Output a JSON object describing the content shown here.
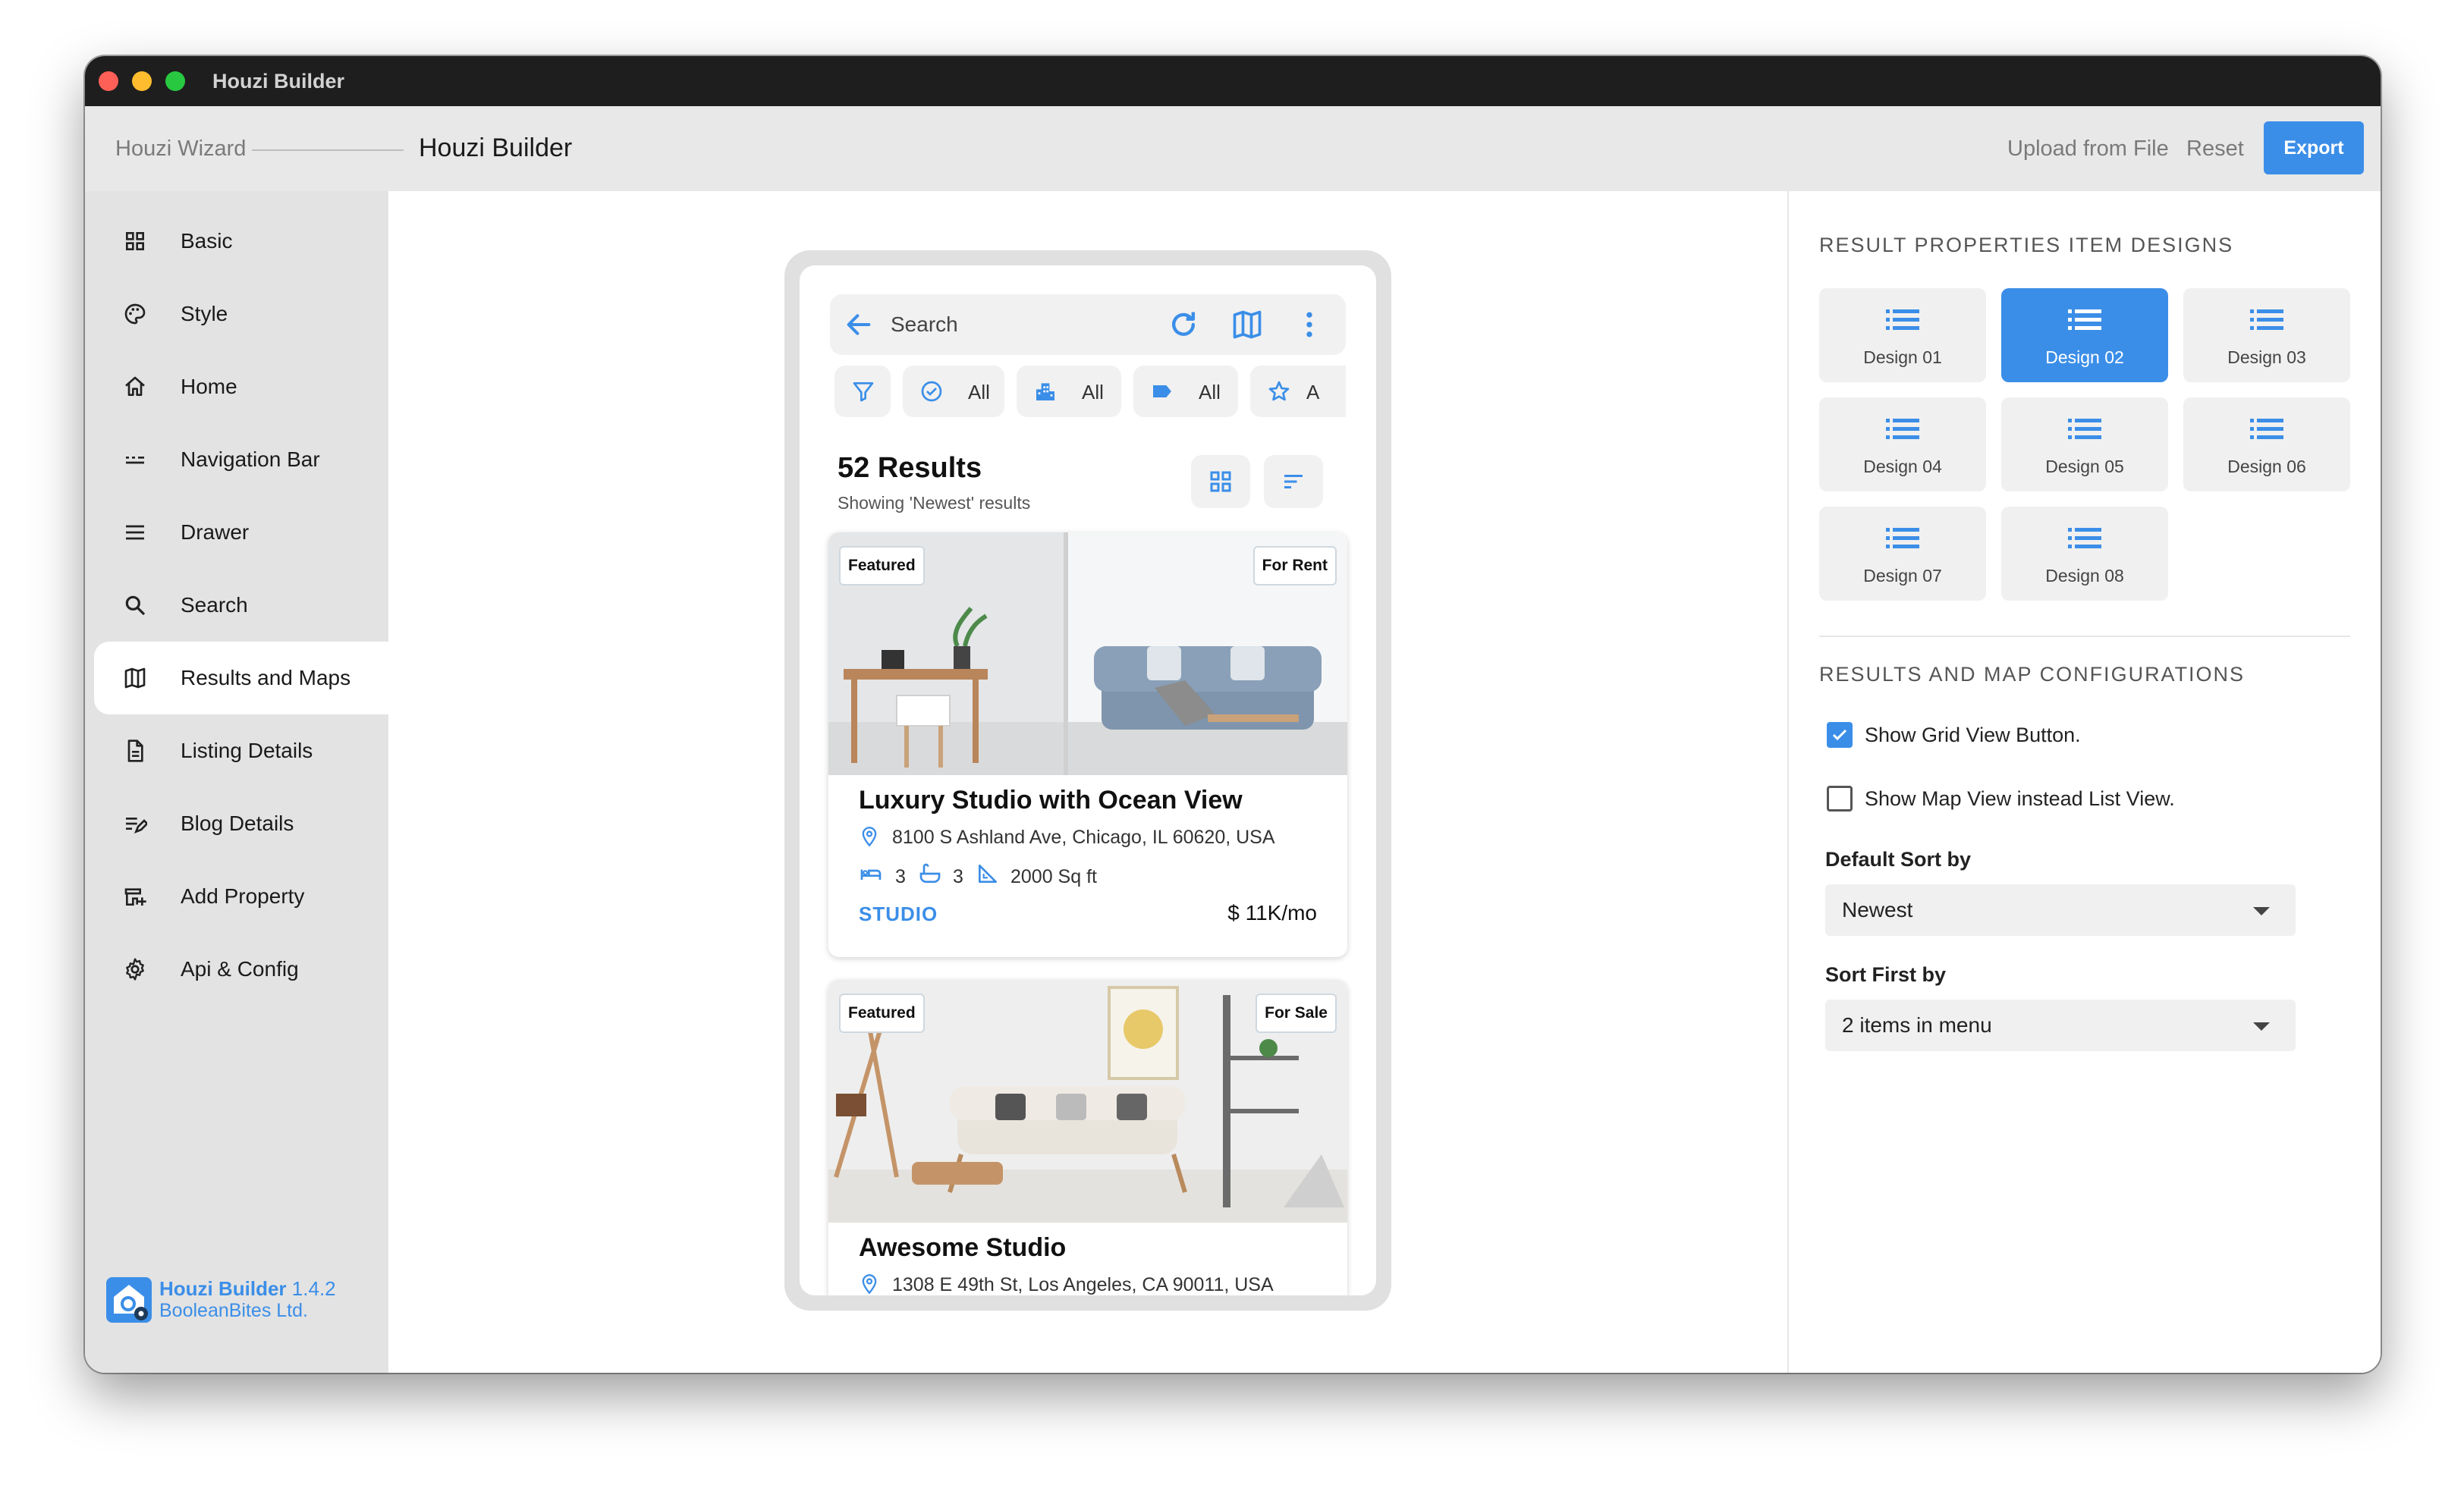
{
  "window": {
    "title": "Houzi Builder"
  },
  "topbar": {
    "breadcrumb_root": "Houzi Wizard",
    "title": "Houzi Builder",
    "upload_label": "Upload from File",
    "reset_label": "Reset",
    "export_label": "Export"
  },
  "sidebar": {
    "items": [
      {
        "label": "Basic",
        "icon": "grid-icon"
      },
      {
        "label": "Style",
        "icon": "palette-icon"
      },
      {
        "label": "Home",
        "icon": "home-icon"
      },
      {
        "label": "Navigation Bar",
        "icon": "navigation-bar-icon"
      },
      {
        "label": "Drawer",
        "icon": "menu-icon"
      },
      {
        "label": "Search",
        "icon": "search-icon"
      },
      {
        "label": "Results and Maps",
        "icon": "map-icon",
        "active": true
      },
      {
        "label": "Listing Details",
        "icon": "document-icon"
      },
      {
        "label": "Blog Details",
        "icon": "edit-list-icon"
      },
      {
        "label": "Add Property",
        "icon": "add-property-icon"
      },
      {
        "label": "Api & Config",
        "icon": "gear-icon"
      }
    ],
    "brand": {
      "name": "Houzi Builder",
      "version": "1.4.2",
      "company": "BooleanBites Ltd."
    }
  },
  "preview": {
    "search_placeholder": "Search",
    "filter_chips": [
      {
        "icon": "funnel-icon",
        "label": ""
      },
      {
        "icon": "check-circle-icon",
        "label": "All"
      },
      {
        "icon": "city-icon",
        "label": "All"
      },
      {
        "icon": "tag-icon",
        "label": "All"
      },
      {
        "icon": "star-icon",
        "label": "A"
      }
    ],
    "results_title": "52 Results",
    "results_subtitle": "Showing 'Newest' results",
    "listings": [
      {
        "badge_left": "Featured",
        "badge_right": "For Rent",
        "title": "Luxury Studio with Ocean View",
        "address": "8100 S Ashland Ave, Chicago, IL 60620, USA",
        "beds": "3",
        "baths": "3",
        "area": "2000 Sq ft",
        "type": "STUDIO",
        "price": "$ 11K/mo"
      },
      {
        "badge_left": "Featured",
        "badge_right": "For Sale",
        "title": "Awesome Studio",
        "address": "1308 E 49th St, Los Angeles, CA 90011, USA"
      }
    ]
  },
  "panel": {
    "designs_title": "RESULT PROPERTIES ITEM DESIGNS",
    "designs": [
      {
        "label": "Design 01"
      },
      {
        "label": "Design 02",
        "selected": true
      },
      {
        "label": "Design 03"
      },
      {
        "label": "Design 04"
      },
      {
        "label": "Design 05"
      },
      {
        "label": "Design 06"
      },
      {
        "label": "Design 07"
      },
      {
        "label": "Design 08"
      }
    ],
    "config_title": "RESULTS AND MAP CONFIGURATIONS",
    "show_grid_label": "Show Grid View Button.",
    "show_grid_checked": true,
    "show_map_label": "Show Map View instead List View.",
    "show_map_checked": false,
    "default_sort_label": "Default Sort by",
    "default_sort_value": "Newest",
    "sort_first_label": "Sort First by",
    "sort_first_value": "2 items in menu"
  },
  "colors": {
    "accent": "#3b8ee8",
    "sidebar_bg": "#e3e3e3",
    "titlebar": "#1e1e1e"
  }
}
